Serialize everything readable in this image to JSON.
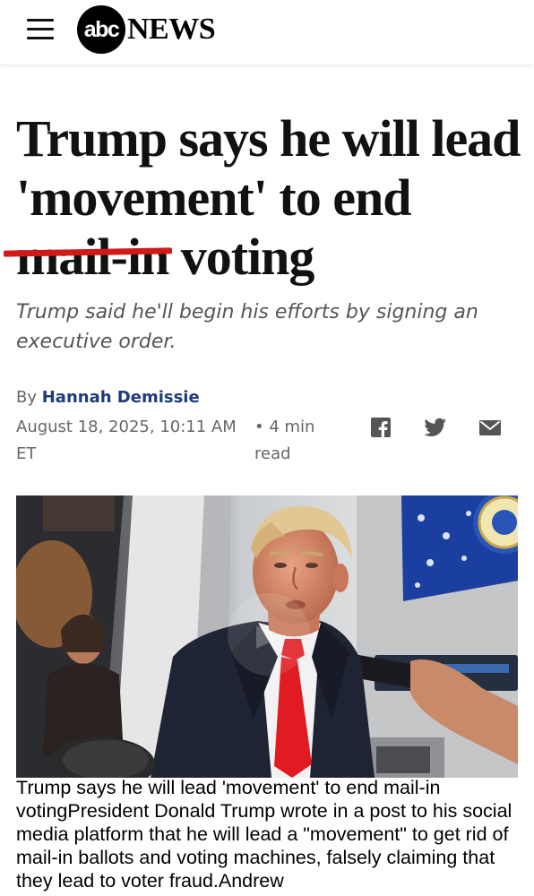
{
  "header": {
    "menu_icon": "hamburger-menu-icon",
    "logo_abc": "abc",
    "logo_news": "NEWS"
  },
  "article": {
    "headline_part1": "Trump says he will lead 'movement' to end ",
    "headline_struck": "mail-in",
    "headline_part2": " voting",
    "subheadline": "Trump said he'll begin his efforts by signing an executive order.",
    "byline_prefix": "By ",
    "author": "Hannah Demissie",
    "date": "August 18, 2025, 10:11 AM ET",
    "read_time": "• 4 min read",
    "share_icons": [
      "facebook-icon",
      "twitter-icon",
      "email-icon"
    ],
    "image_caption": "Trump says he will lead 'movement' to end mail-in votingPresident Donald Trump wrote in a post to his social media platform that he will lead a \"movement\" to get rid of mail-in ballots and voting machines, falsely claiming that they lead to voter fraud.Andrew"
  },
  "colors": {
    "strike": "#d01a1a",
    "author": "#1d3b7a",
    "tie": "#e01b22"
  }
}
